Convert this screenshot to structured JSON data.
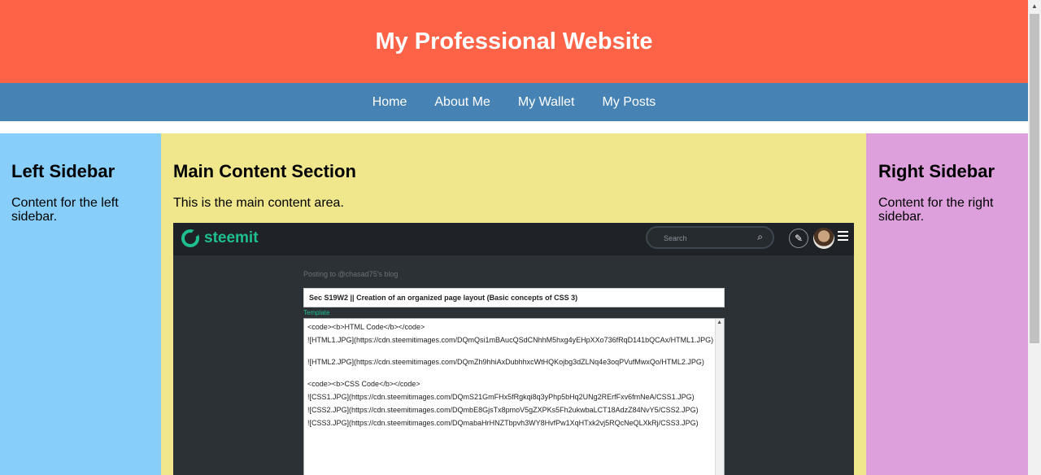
{
  "header": {
    "title": "My Professional Website"
  },
  "nav": {
    "items": [
      "Home",
      "About Me",
      "My Wallet",
      "My Posts"
    ]
  },
  "left_sidebar": {
    "heading": "Left Sidebar",
    "text": "Content for the left sidebar."
  },
  "main": {
    "heading": "Main Content Section",
    "text": "This is the main content area."
  },
  "right_sidebar": {
    "heading": "Right Sidebar",
    "text": "Content for the right sidebar."
  },
  "embedded_screenshot": {
    "logo_text": "steemit",
    "search_placeholder": "Search",
    "posting_to": "Posting to @chasad75's blog",
    "post_title": "Sec S19W2 || Creation of an organized page layout (Basic concepts of CSS 3)",
    "template_label": "Template",
    "editor_lines": [
      "<code><b>HTML Code</b></code>",
      "![HTML1.JPG](https://cdn.steemitimages.com/DQmQsi1mBAucQSdCNhhM5hxg4yEHpXXo736fRqD141bQCAx/HTML1.JPG)",
      "![HTML2.JPG](https://cdn.steemitimages.com/DQmZh9hhiAxDubhhxcWtHQKojbg3dZLNq4e3oqPVufMwxQo/HTML2.JPG)",
      "<code><b>CSS Code</b></code>",
      "![CSS1.JPG](https://cdn.steemitimages.com/DQmS21GmFHx5fRgkqi8q3yPhp5bHq2UNg2RErfFxv6fmNeA/CSS1.JPG)",
      "![CSS2.JPG](https://cdn.steemitimages.com/DQmbE8GjsTx8pmoV5gZXPKs5Fh2ukwbaLCT18AdzZ84NvY5/CSS2.JPG)",
      "![CSS3.JPG](https://cdn.steemitimages.com/DQmabaHrHNZTbpvh3WY8HvfPw1XqHTxk2vj5RQcNeQLXkRj/CSS3.JPG)"
    ]
  },
  "colors": {
    "header_bg": "#ff6347",
    "nav_bg": "#4682b4",
    "left_bg": "#87cefa",
    "main_bg": "#f0e68c",
    "right_bg": "#dda0dd"
  }
}
